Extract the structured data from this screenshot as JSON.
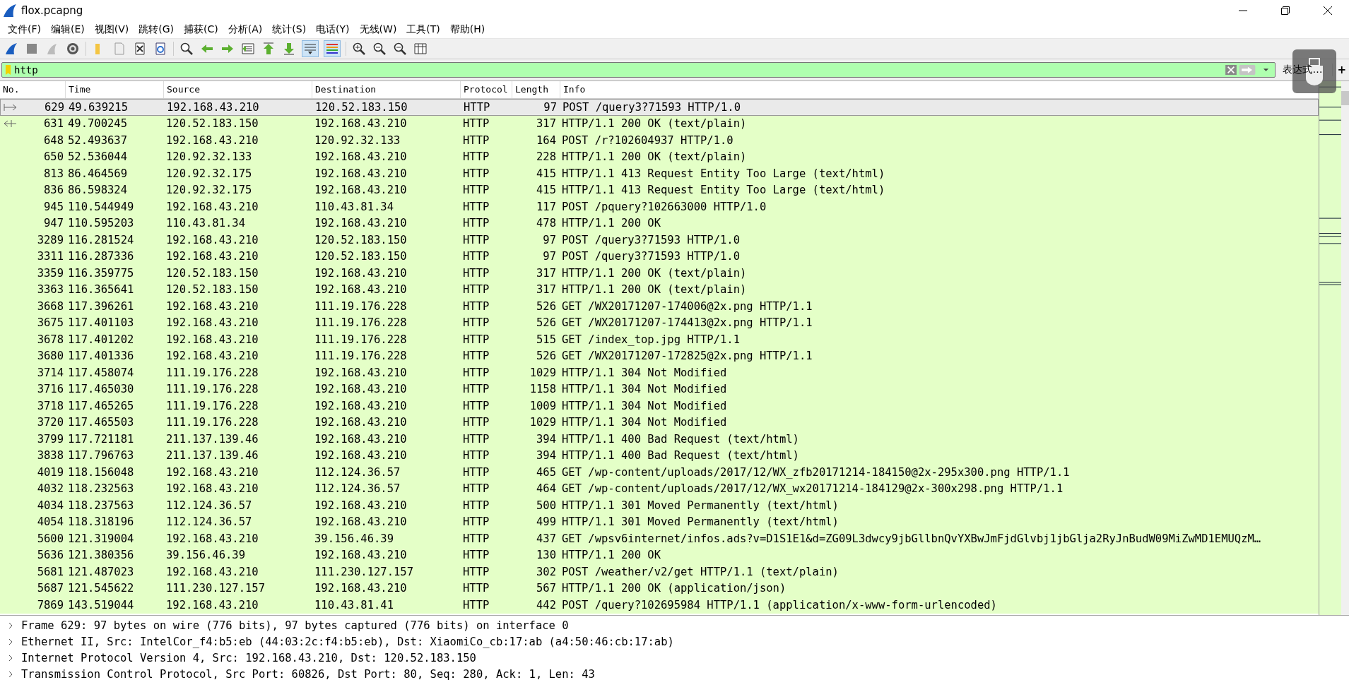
{
  "window": {
    "title": "flox.pcapng"
  },
  "menu": [
    "文件(F)",
    "编辑(E)",
    "视图(V)",
    "跳转(G)",
    "捕获(C)",
    "分析(A)",
    "统计(S)",
    "电话(Y)",
    "无线(W)",
    "工具(T)",
    "帮助(H)"
  ],
  "filter": {
    "value": "http",
    "expression_label": "表达式…",
    "add_label": "+"
  },
  "table": {
    "columns": [
      "No.",
      "Time",
      "Source",
      "Destination",
      "Protocol",
      "Length",
      "Info"
    ],
    "rows": [
      {
        "no": "629",
        "time": "49.639215",
        "src": "192.168.43.210",
        "dst": "120.52.183.150",
        "proto": "HTTP",
        "len": "97",
        "info": "POST /query3?71593 HTTP/1.0",
        "selected": true,
        "kind": "request"
      },
      {
        "no": "631",
        "time": "49.700245",
        "src": "120.52.183.150",
        "dst": "192.168.43.210",
        "proto": "HTTP",
        "len": "317",
        "info": "HTTP/1.1 200 OK  (text/plain)",
        "selected": false,
        "kind": "response"
      },
      {
        "no": "648",
        "time": "52.493637",
        "src": "192.168.43.210",
        "dst": "120.92.32.133",
        "proto": "HTTP",
        "len": "164",
        "info": "POST /r?102604937 HTTP/1.0",
        "selected": false
      },
      {
        "no": "650",
        "time": "52.536044",
        "src": "120.92.32.133",
        "dst": "192.168.43.210",
        "proto": "HTTP",
        "len": "228",
        "info": "HTTP/1.1 200 OK  (text/plain)",
        "selected": false
      },
      {
        "no": "813",
        "time": "86.464569",
        "src": "120.92.32.175",
        "dst": "192.168.43.210",
        "proto": "HTTP",
        "len": "415",
        "info": "HTTP/1.1 413 Request Entity Too Large  (text/html)",
        "selected": false
      },
      {
        "no": "836",
        "time": "86.598324",
        "src": "120.92.32.175",
        "dst": "192.168.43.210",
        "proto": "HTTP",
        "len": "415",
        "info": "HTTP/1.1 413 Request Entity Too Large  (text/html)",
        "selected": false
      },
      {
        "no": "945",
        "time": "110.544949",
        "src": "192.168.43.210",
        "dst": "110.43.81.34",
        "proto": "HTTP",
        "len": "117",
        "info": "POST /pquery?102663000 HTTP/1.0",
        "selected": false
      },
      {
        "no": "947",
        "time": "110.595203",
        "src": "110.43.81.34",
        "dst": "192.168.43.210",
        "proto": "HTTP",
        "len": "478",
        "info": "HTTP/1.1 200 OK",
        "selected": false
      },
      {
        "no": "3289",
        "time": "116.281524",
        "src": "192.168.43.210",
        "dst": "120.52.183.150",
        "proto": "HTTP",
        "len": "97",
        "info": "POST /query3?71593 HTTP/1.0",
        "selected": false
      },
      {
        "no": "3311",
        "time": "116.287336",
        "src": "192.168.43.210",
        "dst": "120.52.183.150",
        "proto": "HTTP",
        "len": "97",
        "info": "POST /query3?71593 HTTP/1.0",
        "selected": false
      },
      {
        "no": "3359",
        "time": "116.359775",
        "src": "120.52.183.150",
        "dst": "192.168.43.210",
        "proto": "HTTP",
        "len": "317",
        "info": "HTTP/1.1 200 OK  (text/plain)",
        "selected": false
      },
      {
        "no": "3363",
        "time": "116.365641",
        "src": "120.52.183.150",
        "dst": "192.168.43.210",
        "proto": "HTTP",
        "len": "317",
        "info": "HTTP/1.1 200 OK  (text/plain)",
        "selected": false
      },
      {
        "no": "3668",
        "time": "117.396261",
        "src": "192.168.43.210",
        "dst": "111.19.176.228",
        "proto": "HTTP",
        "len": "526",
        "info": "GET /WX20171207-174006@2x.png HTTP/1.1",
        "selected": false
      },
      {
        "no": "3675",
        "time": "117.401103",
        "src": "192.168.43.210",
        "dst": "111.19.176.228",
        "proto": "HTTP",
        "len": "526",
        "info": "GET /WX20171207-174413@2x.png HTTP/1.1",
        "selected": false
      },
      {
        "no": "3678",
        "time": "117.401202",
        "src": "192.168.43.210",
        "dst": "111.19.176.228",
        "proto": "HTTP",
        "len": "515",
        "info": "GET /index_top.jpg HTTP/1.1",
        "selected": false
      },
      {
        "no": "3680",
        "time": "117.401336",
        "src": "192.168.43.210",
        "dst": "111.19.176.228",
        "proto": "HTTP",
        "len": "526",
        "info": "GET /WX20171207-172825@2x.png HTTP/1.1",
        "selected": false
      },
      {
        "no": "3714",
        "time": "117.458074",
        "src": "111.19.176.228",
        "dst": "192.168.43.210",
        "proto": "HTTP",
        "len": "1029",
        "info": "HTTP/1.1 304 Not Modified",
        "selected": false
      },
      {
        "no": "3716",
        "time": "117.465030",
        "src": "111.19.176.228",
        "dst": "192.168.43.210",
        "proto": "HTTP",
        "len": "1158",
        "info": "HTTP/1.1 304 Not Modified",
        "selected": false
      },
      {
        "no": "3718",
        "time": "117.465265",
        "src": "111.19.176.228",
        "dst": "192.168.43.210",
        "proto": "HTTP",
        "len": "1009",
        "info": "HTTP/1.1 304 Not Modified",
        "selected": false
      },
      {
        "no": "3720",
        "time": "117.465503",
        "src": "111.19.176.228",
        "dst": "192.168.43.210",
        "proto": "HTTP",
        "len": "1029",
        "info": "HTTP/1.1 304 Not Modified",
        "selected": false
      },
      {
        "no": "3799",
        "time": "117.721181",
        "src": "211.137.139.46",
        "dst": "192.168.43.210",
        "proto": "HTTP",
        "len": "394",
        "info": "HTTP/1.1 400 Bad Request  (text/html)",
        "selected": false
      },
      {
        "no": "3838",
        "time": "117.796763",
        "src": "211.137.139.46",
        "dst": "192.168.43.210",
        "proto": "HTTP",
        "len": "394",
        "info": "HTTP/1.1 400 Bad Request  (text/html)",
        "selected": false
      },
      {
        "no": "4019",
        "time": "118.156048",
        "src": "192.168.43.210",
        "dst": "112.124.36.57",
        "proto": "HTTP",
        "len": "465",
        "info": "GET /wp-content/uploads/2017/12/WX_zfb20171214-184150@2x-295x300.png HTTP/1.1",
        "selected": false
      },
      {
        "no": "4032",
        "time": "118.232563",
        "src": "192.168.43.210",
        "dst": "112.124.36.57",
        "proto": "HTTP",
        "len": "464",
        "info": "GET /wp-content/uploads/2017/12/WX_wx20171214-184129@2x-300x298.png HTTP/1.1",
        "selected": false
      },
      {
        "no": "4034",
        "time": "118.237563",
        "src": "112.124.36.57",
        "dst": "192.168.43.210",
        "proto": "HTTP",
        "len": "500",
        "info": "HTTP/1.1 301 Moved Permanently  (text/html)",
        "selected": false
      },
      {
        "no": "4054",
        "time": "118.318196",
        "src": "112.124.36.57",
        "dst": "192.168.43.210",
        "proto": "HTTP",
        "len": "499",
        "info": "HTTP/1.1 301 Moved Permanently  (text/html)",
        "selected": false
      },
      {
        "no": "5600",
        "time": "121.319004",
        "src": "192.168.43.210",
        "dst": "39.156.46.39",
        "proto": "HTTP",
        "len": "437",
        "info": "GET /wpsv6internet/infos.ads?v=D1S1E1&d=ZG09L3dwcy9jbGllbnQvYXBwJmFjdGlvbj1jbGlja2RyJnBudW09MiZwMD1EMUQzM…",
        "selected": false
      },
      {
        "no": "5636",
        "time": "121.380356",
        "src": "39.156.46.39",
        "dst": "192.168.43.210",
        "proto": "HTTP",
        "len": "130",
        "info": "HTTP/1.1 200 OK",
        "selected": false
      },
      {
        "no": "5681",
        "time": "121.487023",
        "src": "192.168.43.210",
        "dst": "111.230.127.157",
        "proto": "HTTP",
        "len": "302",
        "info": "POST /weather/v2/get HTTP/1.1  (text/plain)",
        "selected": false
      },
      {
        "no": "5687",
        "time": "121.545622",
        "src": "111.230.127.157",
        "dst": "192.168.43.210",
        "proto": "HTTP",
        "len": "567",
        "info": "HTTP/1.1 200 OK  (application/json)",
        "selected": false
      },
      {
        "no": "7869",
        "time": "143.519044",
        "src": "192.168.43.210",
        "dst": "110.43.81.41",
        "proto": "HTTP",
        "len": "442",
        "info": "POST /query?102695984 HTTP/1.1  (application/x-www-form-urlencoded)",
        "selected": false
      }
    ]
  },
  "details": [
    {
      "text": "Frame 629: 97 bytes on wire (776 bits), 97 bytes captured (776 bits) on interface 0",
      "expanded": false
    },
    {
      "text": "Ethernet II, Src: IntelCor_f4:b5:eb (44:03:2c:f4:b5:eb), Dst: XiaomiCo_cb:17:ab (a4:50:46:cb:17:ab)",
      "expanded": false
    },
    {
      "text": "Internet Protocol Version 4, Src: 192.168.43.210, Dst: 120.52.183.150",
      "expanded": false
    },
    {
      "text": "Transmission Control Protocol, Src Port: 60826, Dst Port: 80, Seq: 280, Ack: 1, Len: 43",
      "expanded": false
    }
  ]
}
